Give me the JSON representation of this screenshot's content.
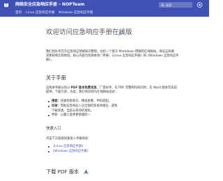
{
  "header": {
    "site_title": "网络安全应急响应手册 – NOPTeam",
    "search_placeholder": "搜索"
  },
  "tabs": [
    {
      "label": "首页"
    },
    {
      "label": "Linux 应急响应手册"
    },
    {
      "label": "Windows 应急响应手册"
    }
  ],
  "main": {
    "title": "欢迎访问应急响应手册在线版",
    "intro": {
      "line1": "我们团队考完于应急响应领域知识整理，总结一个基于 Markdown 撰稿的在线网站，保证这样要",
      "line2": "求那样和实际体验。核心内容包括两本热门手册：《Linux 应急响应手册》和《Windows 应急响应手",
      "line3": "册》。"
    },
    "about_heading": "关于手册",
    "about": {
      "line1_prefix": "这两本手册分别以 ",
      "line1_bold": "PDF 版本免费发放",
      "line1_suffix": "，广受好评。在 PDF 完整制作的同时，在 Word 版本完成前",
      "line2": "提供。下面引述，为此，我们将其转为在线网站形式："
    },
    "bullets": [
      {
        "label": "搜索：",
        "text": "快速检索知识、精准查看、手机适配。"
      },
      {
        "label": "目录：",
        "text": "帮助应急响应人员全面检索查询相应、避免"
      }
    ],
    "bullet_extra": "下载渗透、当前与各项的资料。",
    "bullet_partial": "更新：以最少变更更新版的一",
    "quick_heading": "快速入口",
    "quick_intro": "点击下方链接快速进入手册阅读：",
    "quick_links": [
      {
        "label": "《Linux 应急响应手册》"
      },
      {
        "label": "《Windows 应急响应手册》"
      }
    ],
    "download_heading": "下载 PDF 版本"
  }
}
